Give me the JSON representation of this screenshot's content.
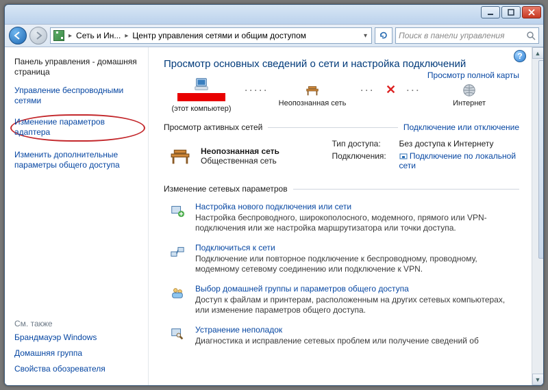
{
  "breadcrumb": {
    "part1": "Сеть и Ин...",
    "part2": "Центр управления сетями и общим доступом"
  },
  "search": {
    "placeholder": "Поиск в панели управления"
  },
  "sidebar": {
    "home": "Панель управления - домашняя страница",
    "wireless": "Управление беспроводными сетями",
    "adapter": "Изменение параметров адаптера",
    "sharing": "Изменить дополнительные параметры общего доступа"
  },
  "seealso": {
    "title": "См. также",
    "firewall": "Брандмауэр Windows",
    "homegroup": "Домашняя группа",
    "inetopts": "Свойства обозревателя"
  },
  "main": {
    "title": "Просмотр основных сведений о сети и настройка подключений",
    "fullmap": "Просмотр полной карты",
    "node_pc_sub": "(этот компьютер)",
    "node_unknown": "Неопознанная сеть",
    "node_internet": "Интернет",
    "active_head": "Просмотр активных сетей",
    "active_action": "Подключение или отключение",
    "net_name": "Неопознанная сеть",
    "net_type": "Общественная сеть",
    "kv_access_k": "Тип доступа:",
    "kv_access_v": "Без доступа к Интернету",
    "kv_conn_k": "Подключения:",
    "kv_conn_v": "Подключение по локальной сети",
    "change_head": "Изменение сетевых параметров",
    "tasks": [
      {
        "title": "Настройка нового подключения или сети",
        "desc": "Настройка беспроводного, широкополосного, модемного, прямого или VPN-подключения или же настройка маршрутизатора или точки доступа."
      },
      {
        "title": "Подключиться к сети",
        "desc": "Подключение или повторное подключение к беспроводному, проводному, модемному сетевому соединению или подключение к VPN."
      },
      {
        "title": "Выбор домашней группы и параметров общего доступа",
        "desc": "Доступ к файлам и принтерам, расположенным на других сетевых компьютерах, или изменение параметров общего доступа."
      },
      {
        "title": "Устранение неполадок",
        "desc": "Диагностика и исправление сетевых проблем или получение сведений об"
      }
    ]
  }
}
